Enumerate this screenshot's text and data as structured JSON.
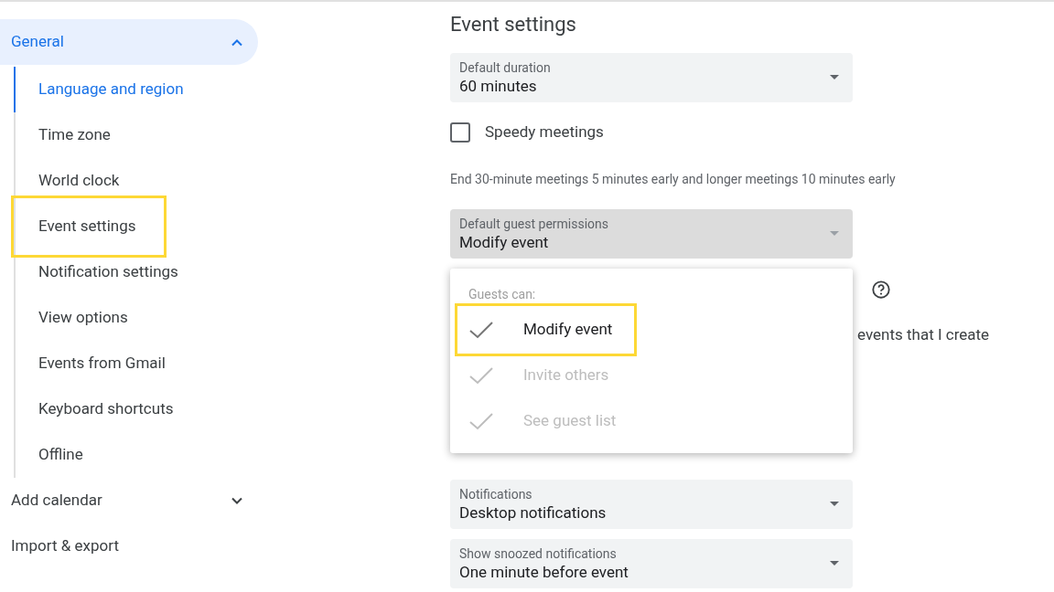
{
  "sidebar": {
    "sections": [
      {
        "label": "General",
        "expanded": true,
        "selected": true,
        "items": [
          {
            "label": "Language and region",
            "selected": true,
            "highlighted": false
          },
          {
            "label": "Time zone",
            "selected": false,
            "highlighted": false
          },
          {
            "label": "World clock",
            "selected": false,
            "highlighted": false
          },
          {
            "label": "Event settings",
            "selected": false,
            "highlighted": true
          },
          {
            "label": "Notification settings",
            "selected": false,
            "highlighted": false
          },
          {
            "label": "View options",
            "selected": false,
            "highlighted": false
          },
          {
            "label": "Events from Gmail",
            "selected": false,
            "highlighted": false
          },
          {
            "label": "Keyboard shortcuts",
            "selected": false,
            "highlighted": false
          },
          {
            "label": "Offline",
            "selected": false,
            "highlighted": false
          }
        ]
      },
      {
        "label": "Add calendar",
        "expanded": false,
        "selected": false
      },
      {
        "label": "Import & export",
        "selected": false
      }
    ]
  },
  "main": {
    "title": "Event settings",
    "top": [
      {
        "kind": "select",
        "label": "Default duration",
        "value": "60 minutes",
        "active": false
      },
      {
        "kind": "checkbox",
        "label": "Speedy meetings",
        "checked": false
      },
      {
        "kind": "note",
        "text": "End 30-minute meetings 5 minutes early and longer meetings 10 minutes early"
      },
      {
        "kind": "select",
        "label": "Default guest permissions",
        "value": "Modify event",
        "active": true
      }
    ],
    "covered": [
      {
        "kind": "help_row"
      },
      {
        "kind": "text_row",
        "text": "events that I create"
      }
    ],
    "menu": {
      "heading": "Guests can:",
      "options": [
        {
          "label": "Modify event",
          "checked": true,
          "disabled": false,
          "highlighted": true
        },
        {
          "label": "Invite others",
          "checked": true,
          "disabled": true,
          "highlighted": false
        },
        {
          "label": "See guest list",
          "checked": true,
          "disabled": true,
          "highlighted": false
        }
      ]
    },
    "bottom": [
      {
        "kind": "select",
        "label": "Notifications",
        "value": "Desktop notifications",
        "active": false
      },
      {
        "kind": "select",
        "label": "Show snoozed notifications",
        "value": "One minute before event",
        "active": false
      }
    ]
  }
}
